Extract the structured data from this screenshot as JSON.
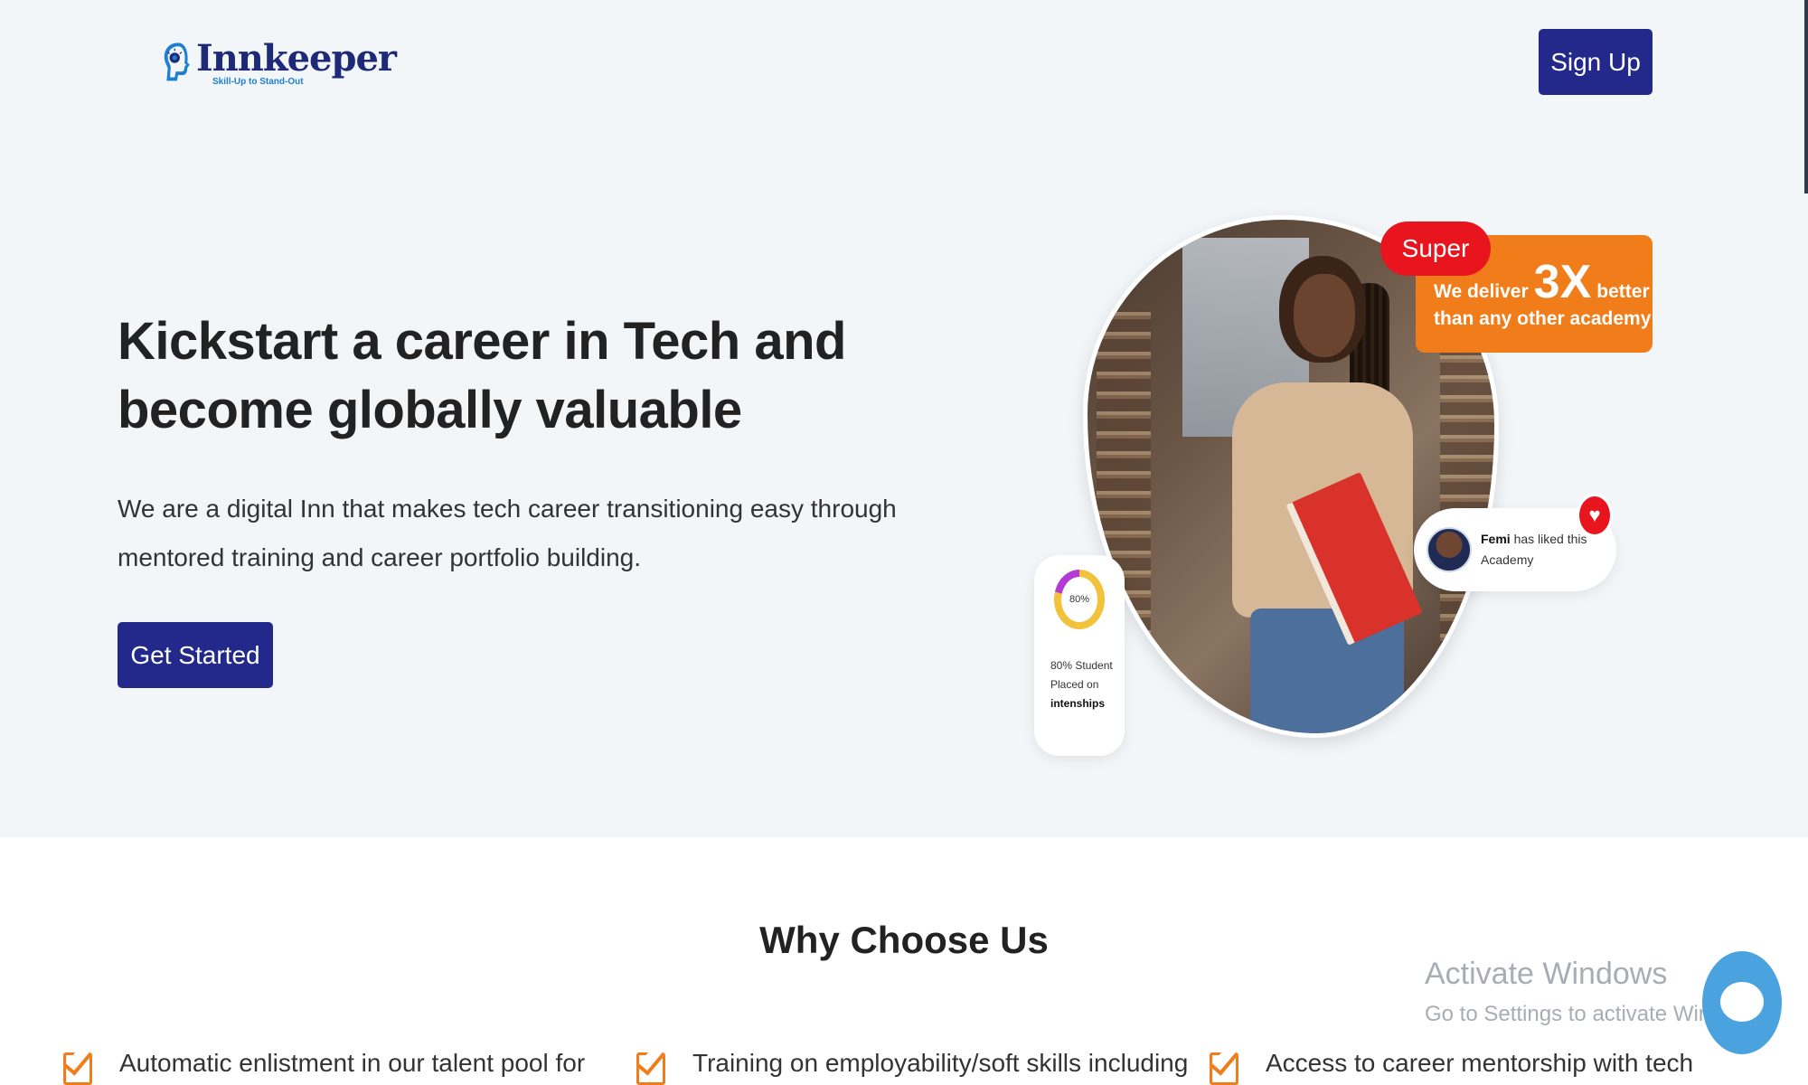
{
  "header": {
    "logo_name": "Innkeeper",
    "logo_tagline": "Skill-Up to Stand-Out",
    "signup_label": "Sign Up"
  },
  "hero": {
    "title": "Kickstart a career in Tech and become globally valuable",
    "subtitle": "We are a digital Inn that makes tech career transitioning easy through mentored training and career portfolio building.",
    "cta_label": "Get Started"
  },
  "badges": {
    "super_label": "Super",
    "deliver_prefix": "We deliver",
    "deliver_big": "3X",
    "deliver_suffix": "better",
    "deliver_line2": "than any other academy",
    "like_name": "Femi",
    "like_text": "has liked this Academy",
    "stat_donut_label": "80%",
    "stat_line1": "80% Student Placed on",
    "stat_line2": "intenships"
  },
  "why": {
    "title": "Why Choose Us",
    "benefits": [
      "Automatic enlistment in our talent pool for",
      "Training on employability/soft skills including",
      "Access to career mentorship with tech"
    ]
  },
  "watermark": {
    "title": "Activate Windows",
    "subtitle": "Go to Settings to activate Windows."
  },
  "colors": {
    "primary": "#23298a",
    "accent_orange": "#f07d1a",
    "accent_red": "#e8151f",
    "hero_bg": "#f3f6f9",
    "chat_blue": "#4aa3de"
  },
  "icons": [
    "logo-head-icon",
    "heart-icon",
    "check-icon",
    "chat-icon"
  ]
}
